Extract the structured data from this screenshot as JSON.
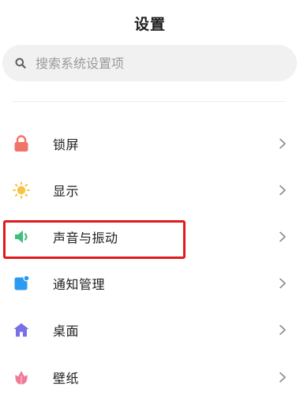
{
  "header": {
    "title": "设置"
  },
  "search": {
    "placeholder": "搜索系统设置项",
    "icon": "search-icon"
  },
  "settings_items": [
    {
      "label": "锁屏",
      "icon": "lock-icon",
      "color": "#f07467"
    },
    {
      "label": "显示",
      "icon": "sun-icon",
      "color": "#f6c443"
    },
    {
      "label": "声音与振动",
      "icon": "speaker-icon",
      "color": "#3ec07a",
      "highlighted": true
    },
    {
      "label": "通知管理",
      "icon": "notification-icon",
      "color": "#2c9af0"
    },
    {
      "label": "桌面",
      "icon": "home-icon",
      "color": "#7b6fe8"
    },
    {
      "label": "壁纸",
      "icon": "flower-icon",
      "color": "#f27a98"
    }
  ],
  "colors": {
    "highlight_border": "#e0191e",
    "chevron": "#8a8a8a"
  }
}
